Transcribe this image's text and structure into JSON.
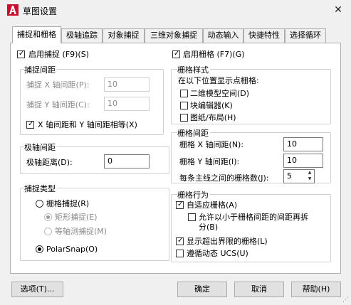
{
  "window": {
    "title": "草图设置",
    "close": "✕"
  },
  "tabs": [
    "捕捉和栅格",
    "极轴追踪",
    "对象捕捉",
    "三维对象捕捉",
    "动态输入",
    "快捷特性",
    "选择循环"
  ],
  "snap": {
    "enable_label": "启用捕捉 (F9)(S)",
    "spacing_group": "捕捉间距",
    "x_label": "捕捉 X 轴间距(P):",
    "x_value": "10",
    "y_label": "捕捉 Y 轴间距(C):",
    "y_value": "10",
    "equal_label": "X 轴间距和 Y 轴间距相等(X)"
  },
  "polar": {
    "group": "极轴间距",
    "distance_label": "极轴距离(D):",
    "distance_value": "0"
  },
  "snap_type": {
    "group": "捕捉类型",
    "grid_snap": "栅格捕捉(R)",
    "rectangular": "矩形捕捉(E)",
    "isometric": "等轴测捕捉(M)",
    "polarsnap": "PolarSnap(O)"
  },
  "grid": {
    "enable_label": "启用栅格 (F7)(G)",
    "style_group": "栅格样式",
    "style_desc": "在以下位置显示点栅格:",
    "model_space": "二维模型空间(D)",
    "block_editor": "块编辑器(K)",
    "sheet_layout": "图纸/布局(H)",
    "spacing_group": "栅格间距",
    "x_label": "栅格 X 轴间距(N):",
    "x_value": "10",
    "y_label": "栅格 Y 轴间距(I):",
    "y_value": "10",
    "major_label": "每条主线之间的栅格数(J):",
    "major_value": "5",
    "behavior_group": "栅格行为",
    "adaptive": "自适应栅格(A)",
    "subdivision_line1": "允许以小于栅格间距的间距再拆",
    "subdivision_line2": "分(B)",
    "beyond_limits": "显示超出界限的栅格(L)",
    "follow_ucs": "遵循动态 UCS(U)"
  },
  "buttons": {
    "options": "选项(T)...",
    "ok": "确定",
    "cancel": "取消",
    "help": "帮助(H)"
  },
  "checkmark": "✓",
  "icons": {
    "app": "autocad-a-icon",
    "close": "close-icon"
  },
  "colors": {
    "app_icon": "#c8102e",
    "dialog_bg": "#f0f0f0",
    "panel_bg": "#ffffff"
  }
}
